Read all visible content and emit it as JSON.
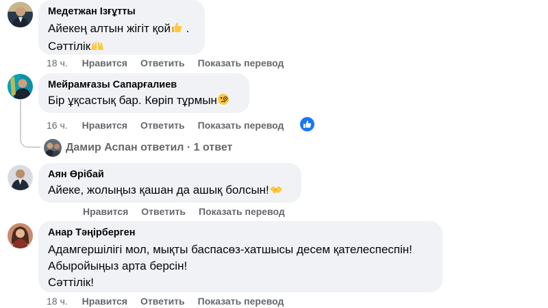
{
  "comments": [
    {
      "author": "Медетжан Ізғұтты",
      "lines": [
        "Айекең алтын жігіт қой",
        "Сәттілік"
      ],
      "time": "18 ч.",
      "like": "Нравится",
      "reply": "Ответить",
      "translate": "Показать перевод",
      "emojis": [
        "thumbs-up-emoji",
        "raised-hands-emoji"
      ]
    },
    {
      "author": "Мейрамғазы Сапарғалиев",
      "lines": [
        "Бір ұқсастық бар. Көріп тұрмын"
      ],
      "time": "16 ч.",
      "like": "Нравится",
      "reply": "Ответить",
      "translate": "Показать перевод",
      "emojis": [
        "face-with-monocle-emoji"
      ],
      "reactions": [
        "like-reaction-icon"
      ],
      "reply_summary": "Дамир Аспан ответил · 1 ответ"
    },
    {
      "author": "Аян Өрібай",
      "lines": [
        "Айеке, жолыңыз қашан да ашық болсын!"
      ],
      "time": "",
      "like": "Нравится",
      "reply": "Ответить",
      "translate": "Показать перевод",
      "emojis": [
        "handshake-emoji"
      ]
    },
    {
      "author": "Анар Тәңірберген",
      "lines": [
        "Адамгершілігі мол, мықты баспасөз-хатшысы десем қателеспеспін!",
        "Абыройыңыз арта берсін!",
        "Сәттілік!"
      ],
      "time": "18 ч.",
      "like": "Нравится",
      "reply": "Ответить",
      "translate": "Показать перевод"
    }
  ]
}
